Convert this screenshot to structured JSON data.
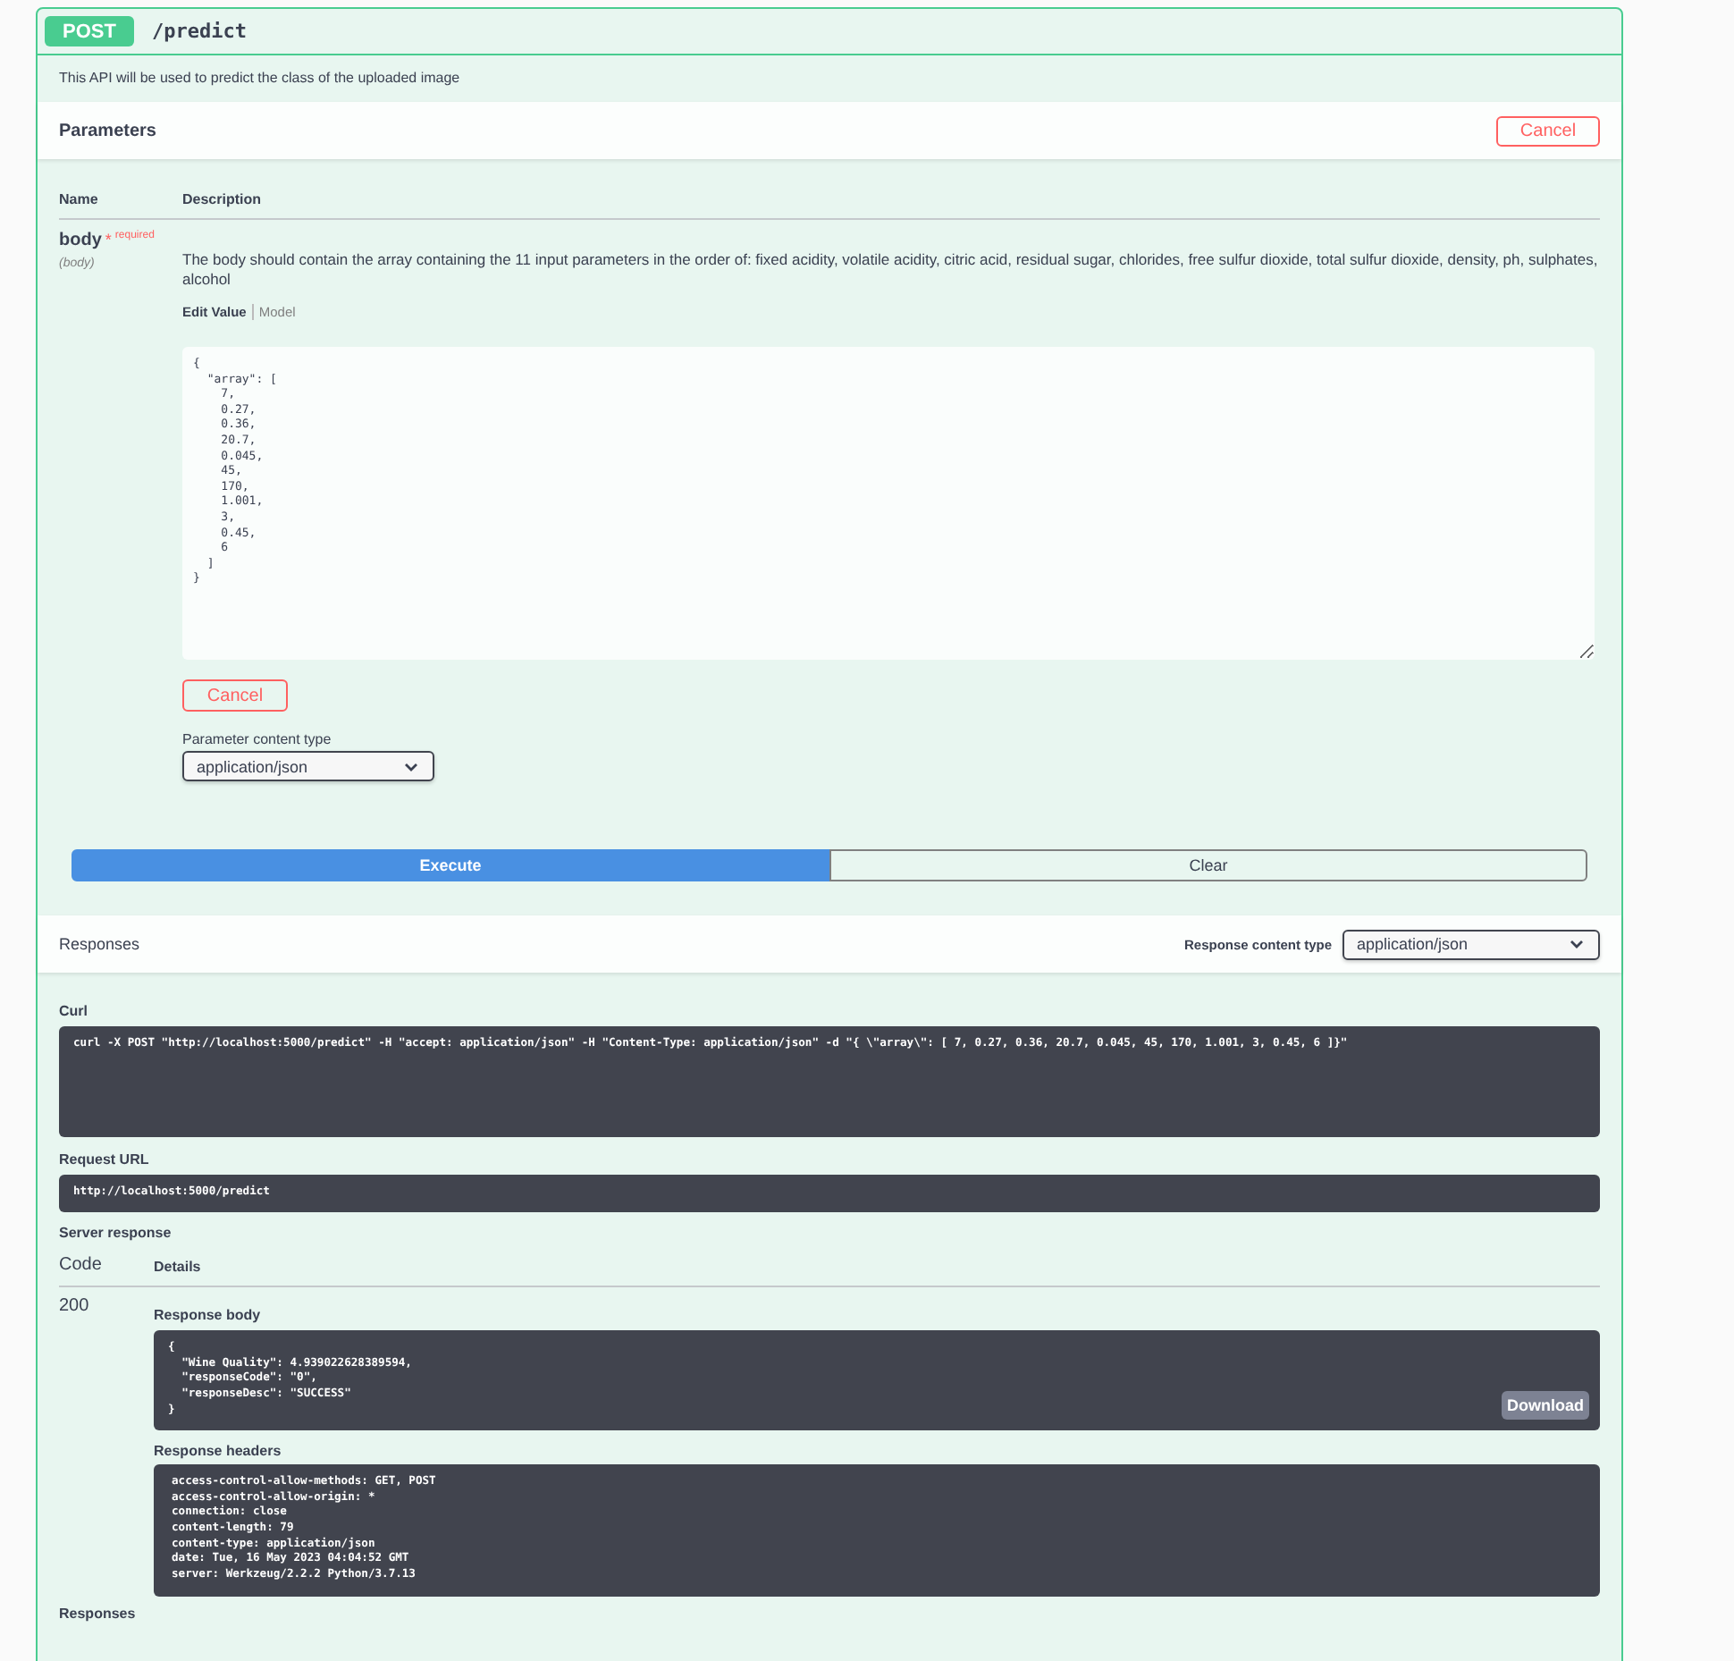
{
  "operation": {
    "method": "POST",
    "path": "/predict",
    "description": "This API will be used to predict the class of the uploaded image"
  },
  "parameters": {
    "title": "Parameters",
    "cancel_label": "Cancel",
    "columns": [
      "Name",
      "Description"
    ],
    "param": {
      "name": "body",
      "required_mark": "*",
      "required_label": "required",
      "location": "(body)",
      "description": "The body should contain the array containing the 11 input parameters in the order of: fixed acidity, volatile acidity, citric acid, residual sugar, chlorides, free sulfur dioxide, total sulfur dioxide, density, ph, sulphates, alcohol",
      "tabs": [
        {
          "label": "Edit Value",
          "selected": true
        },
        {
          "label": "Model",
          "selected": false
        }
      ],
      "value": "{\n  \"array\": [\n    7,\n    0.27,\n    0.36,\n    20.7,\n    0.045,\n    45,\n    170,\n    1.001,\n    3,\n    0.45,\n    6\n  ]\n}",
      "cancel_label": "Cancel",
      "content_type_label": "Parameter content type",
      "content_type": "application/json"
    }
  },
  "actions": [
    {
      "label": "Execute",
      "kind": "primary"
    },
    {
      "label": "Clear",
      "kind": "secondary"
    }
  ],
  "responses": {
    "title": "Responses",
    "content_type_label": "Response content type",
    "content_type": "application/json",
    "curl_label": "Curl",
    "curl": "curl -X POST \"http://localhost:5000/predict\" -H \"accept: application/json\" -H \"Content-Type: application/json\" -d \"{ \\\"array\\\": [ 7, 0.27, 0.36, 20.7, 0.045, 45, 170, 1.001, 3, 0.45, 6 ]}\"",
    "request_url_label": "Request URL",
    "request_url": "http://localhost:5000/predict",
    "server_response_label": "Server response",
    "columns": [
      "Code",
      "Details"
    ],
    "code": "200",
    "body_label": "Response body",
    "body": "{\n  \"Wine Quality\": 4.939022628389594,\n  \"responseCode\": \"0\",\n  \"responseDesc\": \"SUCCESS\"\n}",
    "download_label": "Download",
    "headers_label": "Response headers",
    "headers": "access-control-allow-methods: GET, POST\naccess-control-allow-origin: *\nconnection: close\ncontent-length: 79\ncontent-type: application/json\ndate: Tue, 16 May 2023 04:04:52 GMT\nserver: Werkzeug/2.2.2 Python/3.7.13",
    "footer_title": "Responses"
  }
}
